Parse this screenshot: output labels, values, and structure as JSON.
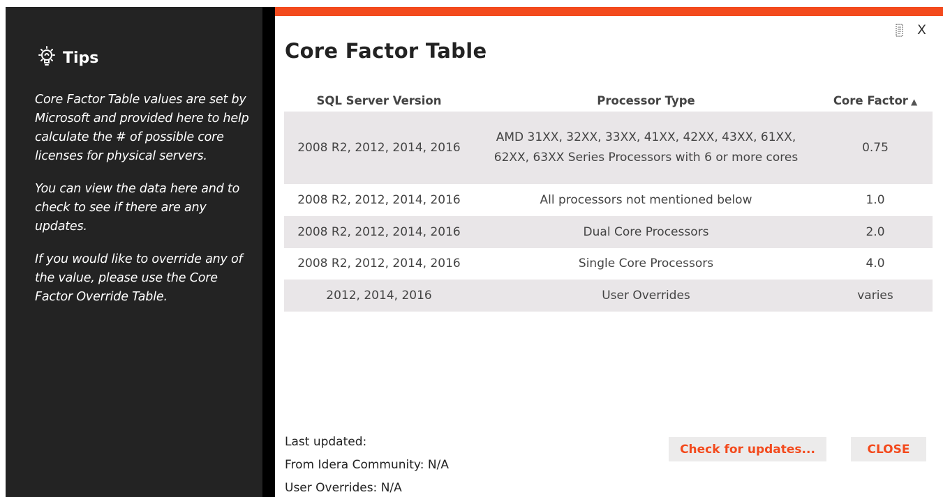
{
  "tips": {
    "title": "Tips",
    "icon": "lightbulb-icon",
    "paragraphs": [
      "Core Factor Table values are set by Microsoft and provided here to help calculate the # of possible core licenses for physical servers.",
      "You can view the data here and to check to see if there are any updates.",
      "If you would like to override any of the value, please use the Core Factor Override Table."
    ]
  },
  "dialog": {
    "title": "Core Factor Table",
    "close_glyph": "X",
    "accent_color": "#f34a1d"
  },
  "table": {
    "headers": [
      "SQL Server Version",
      "Processor Type",
      "Core Factor"
    ],
    "sort_indicator": "▲",
    "rows": [
      {
        "version": "2008 R2, 2012, 2014, 2016",
        "processor": "AMD 31XX, 32XX, 33XX, 41XX, 42XX, 43XX, 61XX, 62XX, 63XX Series Processors with 6 or more cores",
        "factor": "0.75"
      },
      {
        "version": "2008 R2, 2012, 2014, 2016",
        "processor": "All processors not mentioned below",
        "factor": "1.0"
      },
      {
        "version": "2008 R2, 2012, 2014, 2016",
        "processor": "Dual Core Processors",
        "factor": "2.0"
      },
      {
        "version": "2008 R2, 2012, 2014, 2016",
        "processor": "Single Core Processors",
        "factor": "4.0"
      },
      {
        "version": "2012, 2014, 2016",
        "processor": "User Overrides",
        "factor": "varies"
      }
    ]
  },
  "footer": {
    "last_updated": "Last updated:",
    "from_community": "From Idera Community: N/A",
    "user_overrides": "User Overrides: N/A",
    "check_button": "Check for updates...",
    "close_button": "CLOSE"
  }
}
